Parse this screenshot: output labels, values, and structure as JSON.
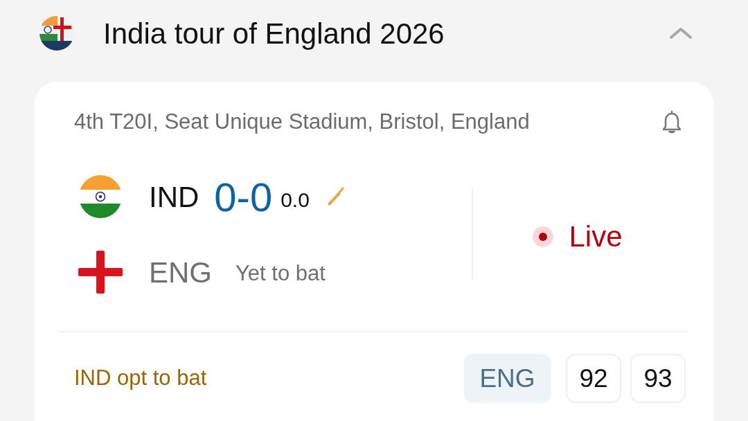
{
  "series": {
    "title": "India tour of England 2026",
    "expanded": true
  },
  "match": {
    "info": "4th T20I, Seat Unique Stadium, Bristol, England",
    "teams": [
      {
        "code": "IND",
        "score": "0-0",
        "overs": "0.0",
        "batting": true
      },
      {
        "code": "ENG",
        "status": "Yet to bat",
        "batting": false
      }
    ],
    "state": "Live",
    "note": "IND opt to bat",
    "badge": "ENG",
    "values": [
      "92",
      "93"
    ]
  }
}
